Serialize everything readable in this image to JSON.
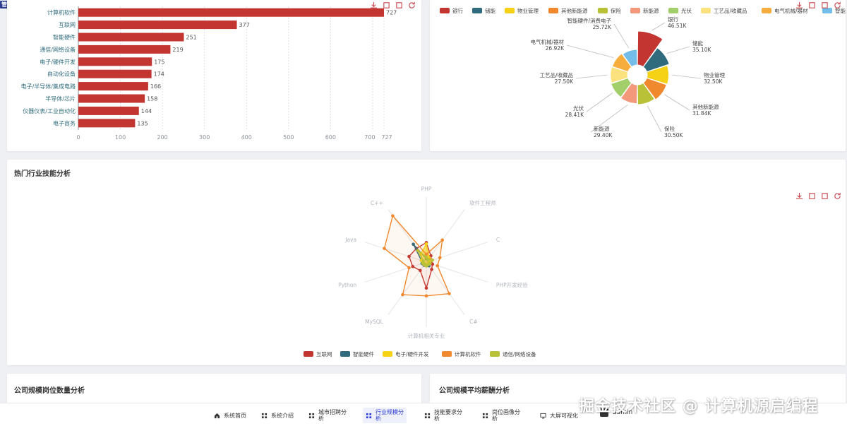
{
  "corner_tag": "管理",
  "cards": {
    "skills_title": "热门行业技能分析",
    "company_count_title": "公司规模岗位数量分析",
    "company_salary_title": "公司规模平均薪酬分析"
  },
  "nav": {
    "items": [
      {
        "label": "系统首页",
        "icon": "home-icon",
        "active": false
      },
      {
        "label": "系统介绍",
        "icon": "grid-icon",
        "active": false
      },
      {
        "label": "城市招聘分析",
        "icon": "grid-icon",
        "active": false
      },
      {
        "label": "行业规模分析",
        "icon": "grid-icon",
        "active": true
      },
      {
        "label": "技能要求分析",
        "icon": "grid-icon",
        "active": false
      },
      {
        "label": "岗位画像分析",
        "icon": "grid-icon",
        "active": false
      },
      {
        "label": "大屏可视化",
        "icon": "monitor-icon",
        "active": false
      }
    ],
    "user": "admin"
  },
  "watermark": "掘金技术社区 @ 计算机源启编程",
  "colors": {
    "red": "#c23531",
    "teal": "#2f6b7c",
    "yellow": "#f5d216",
    "orange": "#f0882e",
    "olive": "#b9c236",
    "salmon": "#f3987b",
    "green": "#a3cf6b",
    "lightyellow": "#fbe27e",
    "amber": "#f6ad3e",
    "sky": "#73bde8",
    "toolbox": "#c8464f"
  },
  "chart_data": [
    {
      "type": "bar",
      "orientation": "horizontal",
      "categories": [
        "计算机软件",
        "互联网",
        "智能硬件",
        "通信/网络设备",
        "电子/硬件开发",
        "自动化设备",
        "电子/半导体/集成电路",
        "半导体/芯片",
        "仪器仪表/工业自动化",
        "电子商务"
      ],
      "values": [
        727,
        377,
        251,
        219,
        175,
        174,
        166,
        158,
        144,
        135
      ],
      "xticks": [
        "0",
        "100",
        "200",
        "300",
        "400",
        "500",
        "600",
        "700",
        "727"
      ],
      "xlim": [
        0,
        727
      ],
      "grid": true
    },
    {
      "type": "pie",
      "rose": true,
      "legend_placement": "top",
      "slices": [
        {
          "name": "银行",
          "value": "46.51K",
          "num": 46.51
        },
        {
          "name": "储能",
          "value": "35.10K",
          "num": 35.1
        },
        {
          "name": "物业管理",
          "value": "32.50K",
          "num": 32.5
        },
        {
          "name": "其他新能源",
          "value": "31.84K",
          "num": 31.84
        },
        {
          "name": "保险",
          "value": "30.50K",
          "num": 30.5
        },
        {
          "name": "新能源",
          "value": "29.40K",
          "num": 29.4
        },
        {
          "name": "光伏",
          "value": "28.41K",
          "num": 28.41
        },
        {
          "name": "工艺品/收藏品",
          "value": "27.50K",
          "num": 27.5
        },
        {
          "name": "电气机械/器材",
          "value": "26.92K",
          "num": 26.92
        },
        {
          "name": "智能硬件/消费电子",
          "value": "25.72K",
          "num": 25.72
        }
      ]
    },
    {
      "type": "radar",
      "indicators": [
        "PHP",
        "软件工程师",
        "C",
        "PHP开发经验",
        "C#",
        "计算机相关专业",
        "MySQL",
        "Python",
        "Java",
        "C++"
      ],
      "legend_placement": "bottom",
      "series": [
        {
          "name": "互联网",
          "values": [
            0.3,
            0.12,
            0.08,
            0.1,
            0.14,
            0.4,
            0.16,
            0.22,
            0.28,
            0.26
          ]
        },
        {
          "name": "智能硬件",
          "values": [
            0.05,
            0.06,
            0.04,
            0.05,
            0.07,
            0.04,
            0.06,
            0.07,
            0.08,
            0.34
          ]
        },
        {
          "name": "电子/硬件开发",
          "values": [
            0.28,
            0.08,
            0.05,
            0.06,
            0.04,
            0.05,
            0.05,
            0.04,
            0.08,
            0.15
          ]
        },
        {
          "name": "计算机软件",
          "values": [
            0.12,
            0.42,
            0.22,
            0.18,
            0.6,
            0.52,
            0.62,
            0.28,
            0.68,
            0.88
          ]
        },
        {
          "name": "通信/网络设备",
          "values": [
            0.08,
            0.05,
            0.1,
            0.06,
            0.05,
            0.06,
            0.04,
            0.06,
            0.05,
            0.22
          ]
        }
      ]
    }
  ]
}
